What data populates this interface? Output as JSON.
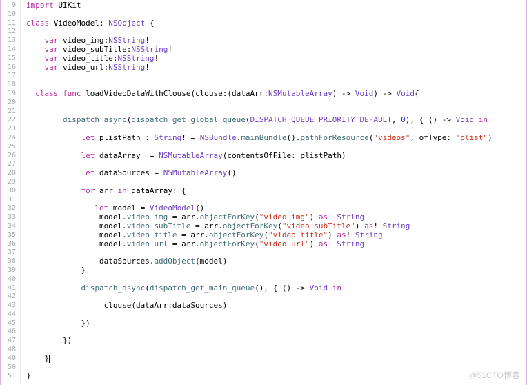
{
  "startLine": 9,
  "endLine": 51,
  "watermark": "@51CTO博客",
  "lines": [
    [
      {
        "t": "kw",
        "v": "import"
      },
      {
        "t": "id",
        "v": " UIKit"
      }
    ],
    [],
    [
      {
        "t": "kw",
        "v": "class"
      },
      {
        "t": "id",
        "v": " VideoModel: "
      },
      {
        "t": "type",
        "v": "NSObject"
      },
      {
        "t": "id",
        "v": " {"
      }
    ],
    [],
    [
      {
        "t": "id",
        "v": "    "
      },
      {
        "t": "kw",
        "v": "var"
      },
      {
        "t": "id",
        "v": " video_img:"
      },
      {
        "t": "type",
        "v": "NSString"
      },
      {
        "t": "id",
        "v": "!"
      }
    ],
    [
      {
        "t": "id",
        "v": "    "
      },
      {
        "t": "kw",
        "v": "var"
      },
      {
        "t": "id",
        "v": " video_subTitle:"
      },
      {
        "t": "type",
        "v": "NSString"
      },
      {
        "t": "id",
        "v": "!"
      }
    ],
    [
      {
        "t": "id",
        "v": "    "
      },
      {
        "t": "kw",
        "v": "var"
      },
      {
        "t": "id",
        "v": " video_title:"
      },
      {
        "t": "type",
        "v": "NSString"
      },
      {
        "t": "id",
        "v": "!"
      }
    ],
    [
      {
        "t": "id",
        "v": "    "
      },
      {
        "t": "kw",
        "v": "var"
      },
      {
        "t": "id",
        "v": " video_url:"
      },
      {
        "t": "type",
        "v": "NSString"
      },
      {
        "t": "id",
        "v": "!"
      }
    ],
    [],
    [],
    [
      {
        "t": "id",
        "v": "  "
      },
      {
        "t": "kw",
        "v": "class"
      },
      {
        "t": "id",
        "v": " "
      },
      {
        "t": "kw",
        "v": "func"
      },
      {
        "t": "id",
        "v": " loadVideoDataWithClouse(clouse:(dataArr:"
      },
      {
        "t": "type",
        "v": "NSMutableArray"
      },
      {
        "t": "id",
        "v": ") -> "
      },
      {
        "t": "type",
        "v": "Void"
      },
      {
        "t": "id",
        "v": ") -> "
      },
      {
        "t": "type",
        "v": "Void"
      },
      {
        "t": "id",
        "v": "{"
      }
    ],
    [],
    [],
    [
      {
        "t": "id",
        "v": "        "
      },
      {
        "t": "fn",
        "v": "dispatch_async"
      },
      {
        "t": "id",
        "v": "("
      },
      {
        "t": "fn",
        "v": "dispatch_get_global_queue"
      },
      {
        "t": "id",
        "v": "("
      },
      {
        "t": "type",
        "v": "DISPATCH_QUEUE_PRIORITY_DEFAULT"
      },
      {
        "t": "id",
        "v": ", "
      },
      {
        "t": "num",
        "v": "0"
      },
      {
        "t": "id",
        "v": "), { () -> "
      },
      {
        "t": "type",
        "v": "Void"
      },
      {
        "t": "id",
        "v": " "
      },
      {
        "t": "kw",
        "v": "in"
      }
    ],
    [],
    [
      {
        "t": "id",
        "v": "            "
      },
      {
        "t": "kw",
        "v": "let"
      },
      {
        "t": "id",
        "v": " plistPath : "
      },
      {
        "t": "type",
        "v": "String"
      },
      {
        "t": "id",
        "v": "! = "
      },
      {
        "t": "type",
        "v": "NSBundle"
      },
      {
        "t": "id",
        "v": "."
      },
      {
        "t": "fn",
        "v": "mainBundle"
      },
      {
        "t": "id",
        "v": "()."
      },
      {
        "t": "fn",
        "v": "pathForResource"
      },
      {
        "t": "id",
        "v": "("
      },
      {
        "t": "str",
        "v": "\"videos\""
      },
      {
        "t": "id",
        "v": ", ofType: "
      },
      {
        "t": "str",
        "v": "\"plist\""
      },
      {
        "t": "id",
        "v": ")"
      }
    ],
    [],
    [
      {
        "t": "id",
        "v": "            "
      },
      {
        "t": "kw",
        "v": "let"
      },
      {
        "t": "id",
        "v": " dataArray  = "
      },
      {
        "t": "type",
        "v": "NSMutableArray"
      },
      {
        "t": "id",
        "v": "(contentsOfFile: plistPath)"
      }
    ],
    [],
    [
      {
        "t": "id",
        "v": "            "
      },
      {
        "t": "kw",
        "v": "let"
      },
      {
        "t": "id",
        "v": " dataSources = "
      },
      {
        "t": "type",
        "v": "NSMutableArray"
      },
      {
        "t": "id",
        "v": "()"
      }
    ],
    [],
    [
      {
        "t": "id",
        "v": "            "
      },
      {
        "t": "kw",
        "v": "for"
      },
      {
        "t": "id",
        "v": " arr "
      },
      {
        "t": "kw",
        "v": "in"
      },
      {
        "t": "id",
        "v": " dataArray! {"
      }
    ],
    [],
    [
      {
        "t": "id",
        "v": "               "
      },
      {
        "t": "kw",
        "v": "let"
      },
      {
        "t": "id",
        "v": " model = "
      },
      {
        "t": "type",
        "v": "VideoModel"
      },
      {
        "t": "id",
        "v": "()"
      }
    ],
    [
      {
        "t": "id",
        "v": "                model."
      },
      {
        "t": "fn",
        "v": "video_img"
      },
      {
        "t": "id",
        "v": " = arr."
      },
      {
        "t": "fn",
        "v": "objectForKey"
      },
      {
        "t": "id",
        "v": "("
      },
      {
        "t": "str",
        "v": "\"video_img\""
      },
      {
        "t": "id",
        "v": ") "
      },
      {
        "t": "kw",
        "v": "as"
      },
      {
        "t": "id",
        "v": "! "
      },
      {
        "t": "type",
        "v": "String"
      }
    ],
    [
      {
        "t": "id",
        "v": "                model."
      },
      {
        "t": "fn",
        "v": "video_subTitle"
      },
      {
        "t": "id",
        "v": " = arr."
      },
      {
        "t": "fn",
        "v": "objectForKey"
      },
      {
        "t": "id",
        "v": "("
      },
      {
        "t": "str",
        "v": "\"video_subTitle\""
      },
      {
        "t": "id",
        "v": ") "
      },
      {
        "t": "kw",
        "v": "as"
      },
      {
        "t": "id",
        "v": "! "
      },
      {
        "t": "type",
        "v": "String"
      }
    ],
    [
      {
        "t": "id",
        "v": "                model."
      },
      {
        "t": "fn",
        "v": "video_title"
      },
      {
        "t": "id",
        "v": " = arr."
      },
      {
        "t": "fn",
        "v": "objectForKey"
      },
      {
        "t": "id",
        "v": "("
      },
      {
        "t": "str",
        "v": "\"video_title\""
      },
      {
        "t": "id",
        "v": ") "
      },
      {
        "t": "kw",
        "v": "as"
      },
      {
        "t": "id",
        "v": "! "
      },
      {
        "t": "type",
        "v": "String"
      }
    ],
    [
      {
        "t": "id",
        "v": "                model."
      },
      {
        "t": "fn",
        "v": "video_url"
      },
      {
        "t": "id",
        "v": " = arr."
      },
      {
        "t": "fn",
        "v": "objectForKey"
      },
      {
        "t": "id",
        "v": "("
      },
      {
        "t": "str",
        "v": "\"video_url\""
      },
      {
        "t": "id",
        "v": ") "
      },
      {
        "t": "kw",
        "v": "as"
      },
      {
        "t": "id",
        "v": "! "
      },
      {
        "t": "type",
        "v": "String"
      }
    ],
    [],
    [
      {
        "t": "id",
        "v": "                dataSources."
      },
      {
        "t": "fn",
        "v": "addObject"
      },
      {
        "t": "id",
        "v": "(model)"
      }
    ],
    [
      {
        "t": "id",
        "v": "            }"
      }
    ],
    [],
    [
      {
        "t": "id",
        "v": "            "
      },
      {
        "t": "fn",
        "v": "dispatch_async"
      },
      {
        "t": "id",
        "v": "("
      },
      {
        "t": "fn",
        "v": "dispatch_get_main_queue"
      },
      {
        "t": "id",
        "v": "(), { () -> "
      },
      {
        "t": "type",
        "v": "Void"
      },
      {
        "t": "id",
        "v": " "
      },
      {
        "t": "kw",
        "v": "in"
      }
    ],
    [],
    [
      {
        "t": "id",
        "v": "                 clouse(dataArr:dataSources)"
      }
    ],
    [],
    [
      {
        "t": "id",
        "v": "            })"
      }
    ],
    [],
    [
      {
        "t": "id",
        "v": "        })"
      }
    ],
    [],
    [
      {
        "t": "id",
        "v": "    }"
      },
      {
        "t": "cursor",
        "v": ""
      }
    ],
    [],
    [
      {
        "t": "id",
        "v": "}"
      }
    ]
  ]
}
